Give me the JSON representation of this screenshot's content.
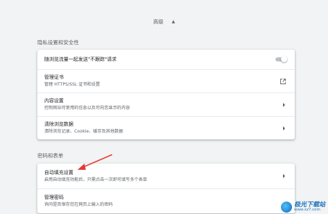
{
  "advanced_header": {
    "label": "高级",
    "chevron_icon": "chevron-up-icon"
  },
  "privacy_section": {
    "title": "隐私设置和安全性",
    "items": [
      {
        "title": "随浏览流量一起发送\"不跟踪\"请求",
        "control": "toggle",
        "state": "off"
      },
      {
        "title": "管理证书",
        "desc": "管理 HTTPS/SSL 证书和设置",
        "control": "external-link-icon"
      },
      {
        "title": "内容设置",
        "desc": "控制网站可使用的信息以及可向您显示的内容",
        "control": "chevron-right-icon"
      },
      {
        "title": "清除浏览数据",
        "desc": "清除浏览记录、Cookie、缓存及其他数据",
        "control": "chevron-right-icon"
      }
    ]
  },
  "password_section": {
    "title": "密码和表单",
    "items": [
      {
        "title": "自动填充设置",
        "desc": "启用自动填充功能后，只需点击一次即可填写多个表单",
        "control": "chevron-right-icon"
      },
      {
        "title": "管理密码",
        "desc": "询问是否保存您在网页上输入的密码",
        "control": ""
      }
    ]
  },
  "annotation": {
    "color": "#e53935"
  },
  "watermark": {
    "name": "极光下载站",
    "url": "www.xz7.com"
  },
  "colors": {
    "background": "#f1f3f4",
    "card": "#ffffff",
    "accent": "#1e73be"
  }
}
